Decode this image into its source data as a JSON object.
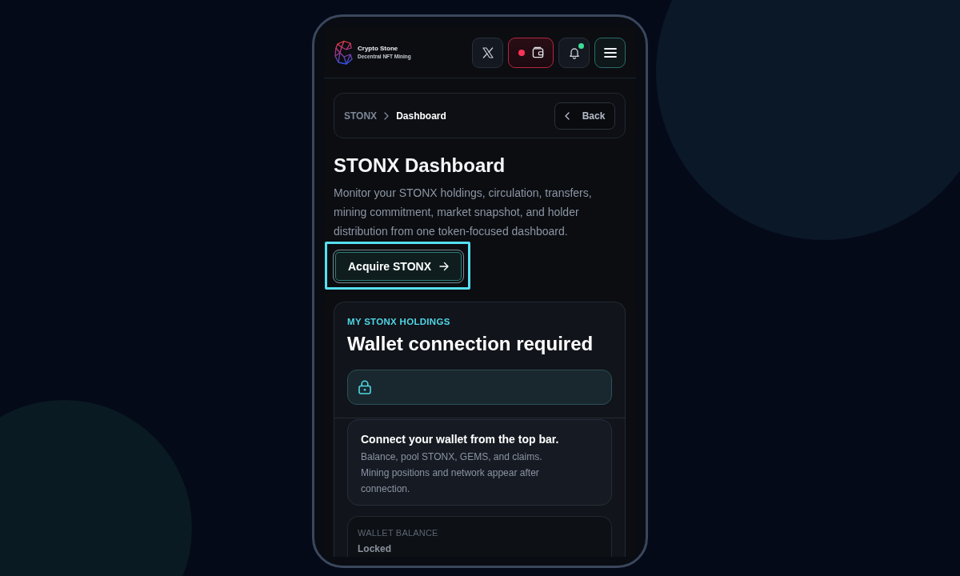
{
  "header": {
    "brand": {
      "name": "Crypto Stone",
      "tagline": "Decentral NFT Mining"
    },
    "actions": [
      {
        "kind": "x"
      },
      {
        "kind": "wallet",
        "connected": false
      },
      {
        "kind": "notifications",
        "unread": true
      },
      {
        "kind": "menu"
      }
    ]
  },
  "breadcrumb": {
    "items": [
      {
        "label": "STONX",
        "current": false
      },
      {
        "label": "Dashboard",
        "current": true
      }
    ],
    "back_button": "Back"
  },
  "page": {
    "title": "STONX Dashboard",
    "description": "Monitor your STONX holdings, circulation, transfers, mining commitment, market snapshot, and holder distribution from one token-focused dashboard.",
    "cta": {
      "label": "Acquire STONX",
      "focused": true
    }
  },
  "holdings": {
    "eyebrow": "MY STONX HOLDINGS",
    "title": "Wallet connection required",
    "locked": true,
    "notice": {
      "title": "Connect your wallet from the top bar.",
      "lines": [
        "Balance, pool STONX, GEMS, and claims.",
        "Mining positions and network appear after connection."
      ]
    },
    "stats": [
      {
        "label": "WALLET BALANCE",
        "value": "Locked"
      }
    ]
  }
}
